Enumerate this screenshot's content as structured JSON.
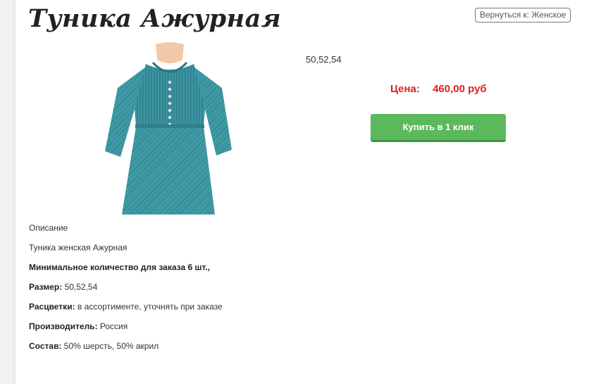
{
  "product": {
    "title": "Туника Ажурная",
    "sizes_line": "50,52,54",
    "image_icon": "tunic-product-photo"
  },
  "nav": {
    "back_label": "Вернуться к: Женское"
  },
  "purchase": {
    "price_label": "Цена:",
    "price_value": "460,00 руб",
    "buy_label": "Купить в 1 клик",
    "colors": {
      "price": "#e02020",
      "button": "#5cb85c"
    }
  },
  "description": {
    "heading": "Описание",
    "text": "Туника женская Ажурная",
    "min_order": "Минимальное количество для заказа 6 шт.,",
    "size_label": "Размер:",
    "size_value": "50,52,54",
    "colors_label": "Расцветки:",
    "colors_value": "в ассортименте, уточнять при заказе",
    "maker_label": "Производитель:",
    "maker_value": "Россия",
    "composition_label": "Состав:",
    "composition_value": "50% шерсть, 50% акрил"
  }
}
